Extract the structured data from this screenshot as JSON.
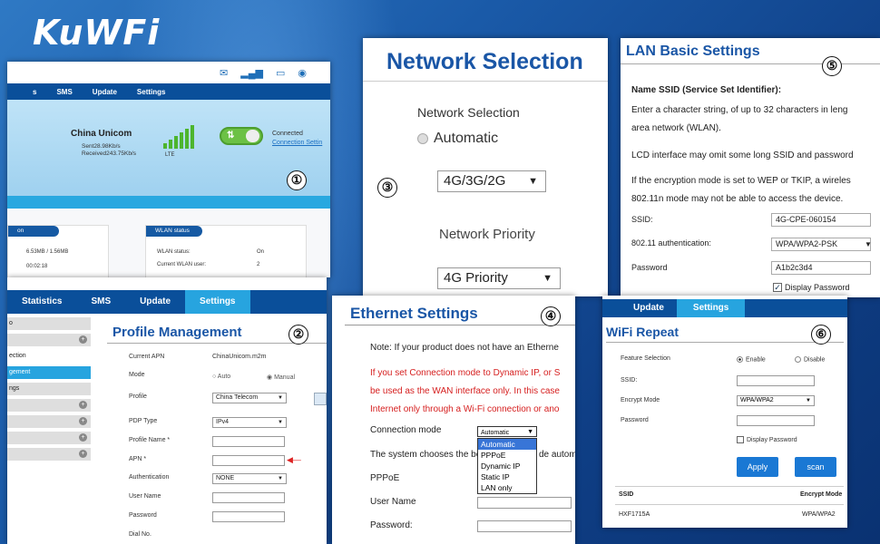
{
  "brand": {
    "logo": "KuWFi"
  },
  "panel1": {
    "num": "①",
    "nav": [
      "s",
      "SMS",
      "Update",
      "Settings"
    ],
    "carrier": "China Unicom",
    "sent": "Sent28.98Kb/s",
    "received": "Received243.75Kb/s",
    "network_type": "LTE",
    "status": "Connected",
    "settings_link": "Connection Settin",
    "left_card_head": "on",
    "left_usage": "6.53MB / 1.56MB",
    "left_time": "00:02:18",
    "wlan_head": "WLAN status",
    "wlan_status_label": "WLAN status:",
    "wlan_status_value": "On",
    "wlan_user_label": "Current WLAN user:",
    "wlan_user_value": "2"
  },
  "panel2": {
    "num": "②",
    "nav": [
      "Statistics",
      "SMS",
      "Update",
      "Settings"
    ],
    "side": [
      {
        "label": "o",
        "state": "normal"
      },
      {
        "label": "",
        "state": "plus"
      },
      {
        "label": "ection",
        "state": "normal"
      },
      {
        "label": "gement",
        "state": "active"
      },
      {
        "label": "ngs",
        "state": "normal"
      },
      {
        "label": "",
        "state": "plus"
      },
      {
        "label": "",
        "state": "plus"
      },
      {
        "label": "",
        "state": "plus"
      },
      {
        "label": "",
        "state": "plus"
      }
    ],
    "title": "Profile Management",
    "current_apn_label": "Current APN",
    "current_apn_value": "ChinaUnicom.m2m",
    "mode_label": "Mode",
    "mode_auto": "Auto",
    "mode_manual": "Manual",
    "profile_label": "Profile",
    "profile_value": "China Telecom",
    "pdp_label": "PDP Type",
    "pdp_value": "IPv4",
    "profile_name_label": "Profile Name *",
    "apn_label": "APN *",
    "auth_label": "Authentication",
    "auth_value": "NONE",
    "user_label": "User Name",
    "password_label": "Password",
    "dial_label": "Dial No."
  },
  "panel3": {
    "num": "③",
    "title": "Network Selection",
    "label": "Network Selection",
    "radio": "Automatic",
    "mode_value": "4G/3G/2G",
    "priority_label": "Network Priority",
    "priority_value": "4G Priority"
  },
  "panel4": {
    "num": "④",
    "title": "Ethernet Settings",
    "note": "Note: If your product does not have an Etherne",
    "red1": "If you set Connection mode to Dynamic IP, or S",
    "red2": "be used as the WAN interface only. In this case",
    "red3": "Internet only through a Wi-Fi connection or ano",
    "cm_label": "Connection mode",
    "cm_value": "Automatic",
    "options": [
      "Automatic",
      "PPPoE",
      "Dynamic IP",
      "Static IP",
      "LAN only"
    ],
    "sys_text_a": "The system chooses the bes",
    "sys_text_b": "de autom",
    "pppoe": "PPPoE",
    "user_label": "User Name",
    "password_label": "Password:"
  },
  "panel5": {
    "num": "⑤",
    "title": "LAN Basic Settings",
    "heading": "Name SSID (Service Set Identifier):",
    "t1": "Enter a character string, of up to 32 characters in leng",
    "t2": "area network (WLAN).",
    "t3": "LCD interface may omit some long SSID and password",
    "t4": "If the encryption mode is set to WEP or TKIP, a wireles",
    "t5": "802.11n mode may not be able to access the device.",
    "ssid_label": "SSID:",
    "ssid_value": "4G-CPE-060154",
    "auth_label": "802.11 authentication:",
    "auth_value": "WPA/WPA2-PSK",
    "pw_label": "Password",
    "pw_value": "A1b2c3d4",
    "display_pw": "Display Password"
  },
  "panel6": {
    "num": "⑥",
    "nav": [
      "Update",
      "Settings"
    ],
    "title": "WiFi Repeat",
    "feature_label": "Feature Selection",
    "enable": "Enable",
    "disable": "Disable",
    "ssid_label": "SSID:",
    "encrypt_label": "Encrypt Mode",
    "encrypt_value": "WPA/WPA2",
    "password_label": "Password",
    "display_pw": "Display Password",
    "apply": "Apply",
    "scan": "scan",
    "col_ssid": "SSID",
    "col_encrypt": "Encrypt Mode",
    "row_ssid": "HXF1715A",
    "row_encrypt": "WPA/WPA2"
  }
}
